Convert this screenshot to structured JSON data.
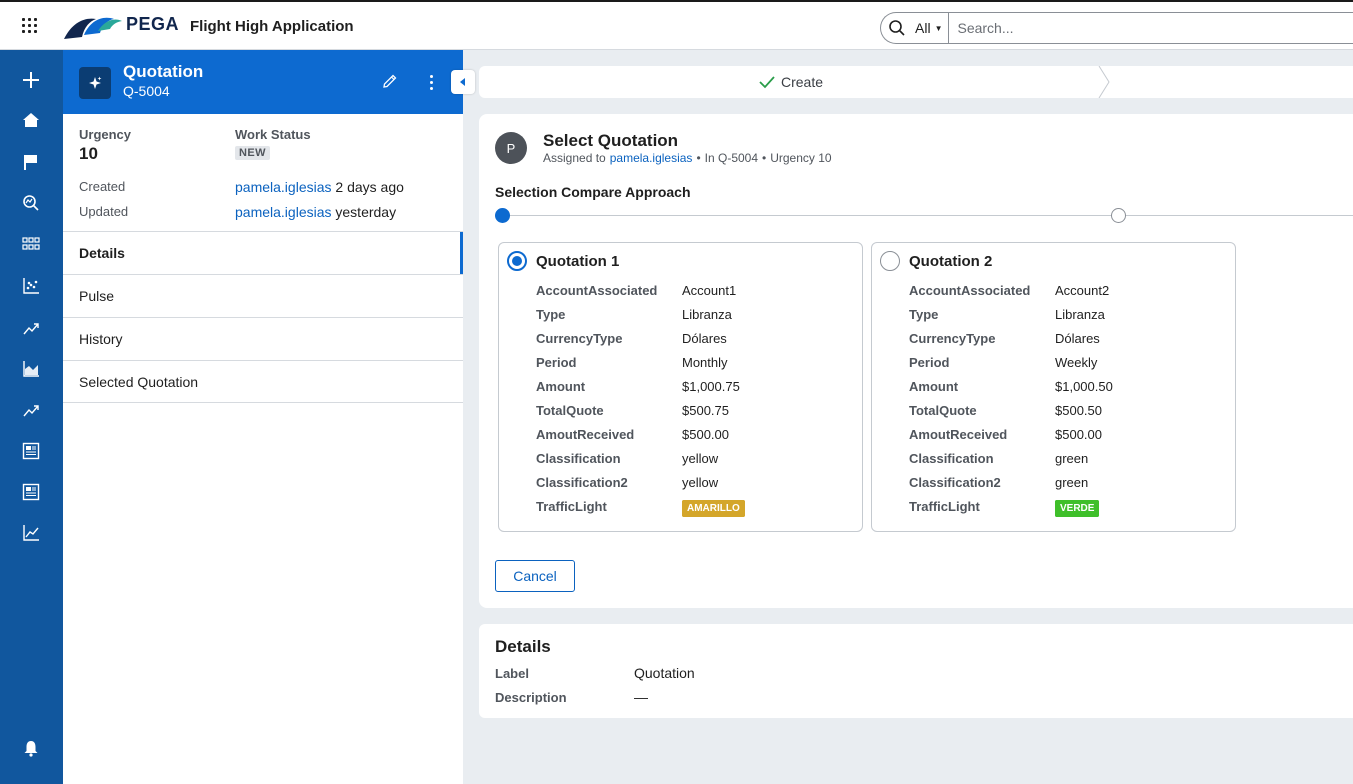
{
  "header": {
    "brand": "PEGA",
    "app_title": "Flight High Application",
    "search_scope": "All",
    "search_placeholder": "Search..."
  },
  "nav": {
    "icons": [
      "plus-icon",
      "home-icon",
      "flag-icon",
      "search-analytics-icon",
      "grid-icon",
      "scatter-chart-icon",
      "trend-icon",
      "area-chart-icon",
      "trend-icon",
      "report-icon",
      "report-icon",
      "line-chart-icon",
      "bell-icon"
    ]
  },
  "case": {
    "title": "Quotation",
    "id": "Q-5004",
    "urgency_label": "Urgency",
    "urgency_value": "10",
    "work_status_label": "Work Status",
    "work_status_value": "NEW",
    "created_label": "Created",
    "created_user": "pamela.iglesias",
    "created_time": "2 days ago",
    "updated_label": "Updated",
    "updated_user": "pamela.iglesias",
    "updated_time": "yesterday",
    "tabs": [
      {
        "label": "Details",
        "active": true
      },
      {
        "label": "Pulse",
        "active": false
      },
      {
        "label": "History",
        "active": false
      },
      {
        "label": "Selected Quotation",
        "active": false
      }
    ]
  },
  "stage": {
    "label": "Create"
  },
  "assignment": {
    "avatar": "P",
    "title": "Select Quotation",
    "assigned_prefix": "Assigned to",
    "assigned_user": "pamela.iglesias",
    "case_ref": "In Q-5004",
    "urgency": "Urgency 10",
    "section_title": "Selection Compare Approach",
    "quotations": [
      {
        "name": "Quotation 1",
        "selected": true,
        "fields": [
          {
            "label": "AccountAssociated",
            "value": "Account1"
          },
          {
            "label": "Type",
            "value": "Libranza"
          },
          {
            "label": "CurrencyType",
            "value": "Dólares"
          },
          {
            "label": "Period",
            "value": "Monthly"
          },
          {
            "label": "Amount",
            "value": "$1,000.75"
          },
          {
            "label": "TotalQuote",
            "value": "$500.75"
          },
          {
            "label": "AmoutReceived",
            "value": "$500.00"
          },
          {
            "label": "Classification",
            "value": "yellow"
          },
          {
            "label": "Classification2",
            "value": "yellow"
          }
        ],
        "traffic_label": "TrafficLight",
        "traffic_value": "AMARILLO",
        "traffic_color": "#d4a62a"
      },
      {
        "name": "Quotation 2",
        "selected": false,
        "fields": [
          {
            "label": "AccountAssociated",
            "value": "Account2"
          },
          {
            "label": "Type",
            "value": "Libranza"
          },
          {
            "label": "CurrencyType",
            "value": "Dólares"
          },
          {
            "label": "Period",
            "value": "Weekly"
          },
          {
            "label": "Amount",
            "value": "$1,000.50"
          },
          {
            "label": "TotalQuote",
            "value": "$500.50"
          },
          {
            "label": "AmoutReceived",
            "value": "$500.00"
          },
          {
            "label": "Classification",
            "value": "green"
          },
          {
            "label": "Classification2",
            "value": "green"
          }
        ],
        "traffic_label": "TrafficLight",
        "traffic_value": "VERDE",
        "traffic_color": "#3fbf2a"
      }
    ],
    "cancel_label": "Cancel"
  },
  "details": {
    "title": "Details",
    "label_label": "Label",
    "label_value": "Quotation",
    "description_label": "Description",
    "description_value": "—"
  },
  "colors": {
    "nav": "#11579e",
    "case_header": "#0d6ad0",
    "link": "#0b62bf"
  }
}
